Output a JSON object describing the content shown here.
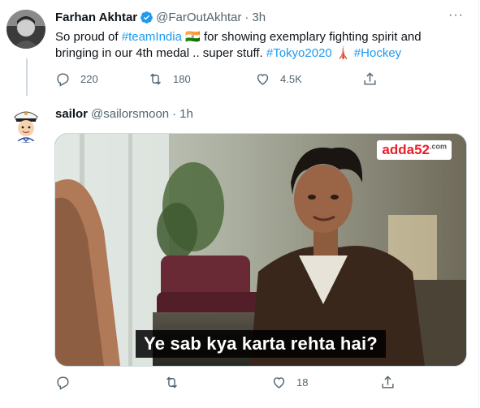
{
  "tweet1": {
    "name": "Farhan Akhtar",
    "handle": "@FarOutAkhtar",
    "separator": "·",
    "time": "3h",
    "text_parts": [
      {
        "t": "So proud of ",
        "link": false
      },
      {
        "t": "#teamIndia",
        "link": true
      },
      {
        "t": " 🇮🇳 for showing exemplary fighting spirit and bringing in our 4th medal .. super stuff. ",
        "link": false
      },
      {
        "t": "#Tokyo2020",
        "link": true
      },
      {
        "t": " 🗼 ",
        "link": false
      },
      {
        "t": "#Hockey",
        "link": true
      }
    ],
    "replies": "220",
    "retweets": "180",
    "likes": "4.5K"
  },
  "tweet2": {
    "name": "sailor",
    "handle": "@sailorsmoon",
    "separator": "·",
    "time": "1h",
    "media_caption": "Ye sab kya karta rehta hai?",
    "media_logo": "adda52",
    "media_logo_suffix": ".com",
    "replies": "",
    "retweets": "",
    "likes": "18"
  },
  "colors": {
    "link": "#1d9bf0",
    "muted": "#536471",
    "verified": "#1d9bf0"
  },
  "icons": [
    "more-icon",
    "verified-icon",
    "reply-icon",
    "retweet-icon",
    "like-icon",
    "share-icon",
    "hockey-emoji-icon"
  ]
}
